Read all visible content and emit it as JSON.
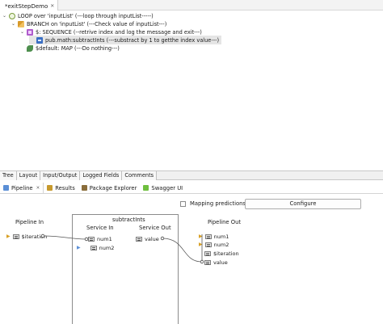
{
  "editor": {
    "tab_title": "*exitStepDemo",
    "tab_close": "✕"
  },
  "flow": {
    "rows": [
      {
        "twisty": "⌄",
        "text": "LOOP over 'inputList' (---loop through inputList-----)",
        "icon": "loop-icon"
      },
      {
        "twisty": "⌄",
        "text": "BRANCH on 'inputList' (---Check value of inputList---)",
        "icon": "branch-icon"
      },
      {
        "twisty": "⌄",
        "text": "$: SEQUENCE (--retrive index and log the message and exit---)",
        "icon": "sequence-icon"
      },
      {
        "twisty": "",
        "text": "pub.math:subtractInts (---substract by 1 to getthe index value---)",
        "icon": "invoke-icon"
      },
      {
        "twisty": "",
        "text": "$default: MAP (---Do nothing---)",
        "icon": "map-icon"
      }
    ]
  },
  "lower_tabs": [
    "Tree",
    "Layout",
    "Input/Output",
    "Logged Fields",
    "Comments"
  ],
  "view_tabs": [
    {
      "label": "Pipeline",
      "icon": "pipeline-icon",
      "close": "✕"
    },
    {
      "label": "Results",
      "icon": "results-icon"
    },
    {
      "label": "Package Explorer",
      "icon": "package-icon"
    },
    {
      "label": "Swagger UI",
      "icon": "swagger-icon"
    }
  ],
  "mapping_predictions_label": "Mapping predictions",
  "configure_label": "Configure",
  "pipeline": {
    "pipeline_in_title": "Pipeline In",
    "pipeline_in_fields": [
      "$iteration"
    ],
    "service_name": "subtractInts",
    "service_in_title": "Service In",
    "service_in_fields": [
      "num1",
      "num2"
    ],
    "service_out_title": "Service Out",
    "service_out_fields": [
      "value"
    ],
    "pipeline_out_title": "Pipeline Out",
    "pipeline_out_fields": [
      "num1",
      "num2",
      "$iteration",
      "value"
    ]
  },
  "colors": {
    "accent_arrow": "#d8a024",
    "selection": "#e5e5e5"
  }
}
